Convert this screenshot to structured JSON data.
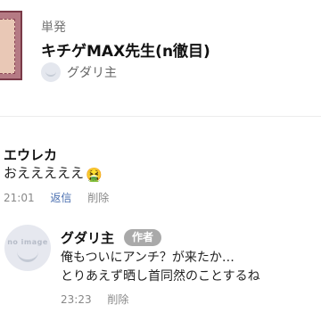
{
  "work": {
    "series_label": "単発",
    "title": "キチゲMAX先生(n徹目)",
    "author": "グダリ主"
  },
  "comments": [
    {
      "user": "エウレカ",
      "text": "おえええええ",
      "emoji": "🤮",
      "time": "21:01",
      "reply_label": "返信",
      "delete_label": "削除"
    },
    {
      "user": "グダリ主",
      "badge": "作者",
      "avatar_text": "no image",
      "lines": [
        "俺もついにアンチ？が来たか…",
        "とりあえず晒し首同然のことするね"
      ],
      "time": "23:23",
      "delete_label": "削除"
    }
  ]
}
